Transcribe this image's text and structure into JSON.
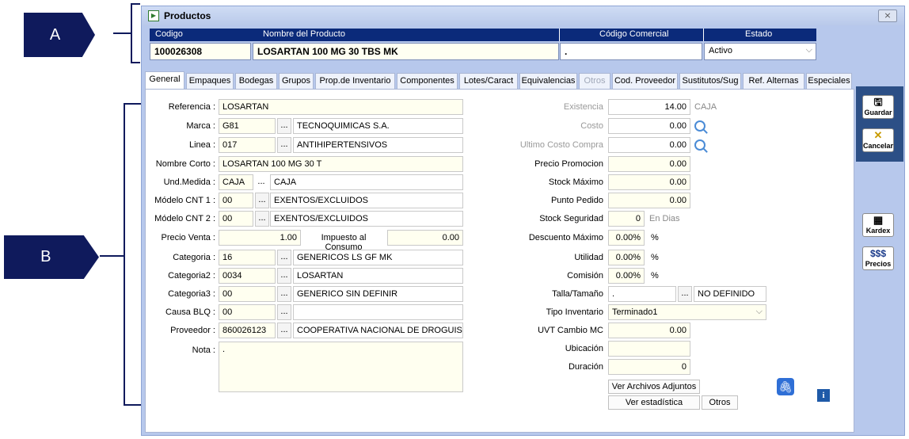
{
  "callouts": {
    "a": "A",
    "b": "B"
  },
  "window": {
    "title": "Productos",
    "close_glyph": "⨯"
  },
  "header": {
    "cols": {
      "codigo": "Codigo",
      "nombre": "Nombre del Producto",
      "comercial": "Código Comercial",
      "estado": "Estado"
    },
    "values": {
      "codigo": "100026308",
      "nombre": "LOSARTAN 100 MG 30 TBS MK",
      "comercial": ".",
      "estado": "Activo"
    }
  },
  "tabs": [
    "General",
    "Empaques",
    "Bodegas",
    "Grupos",
    "Prop.de Inventario",
    "Componentes",
    "Lotes/Caract",
    "Equivalencias",
    "Otros",
    "Cod. Proveedor",
    "Sustitutos/Sug",
    "Ref. Alternas",
    "Especiales"
  ],
  "left": {
    "referencia": {
      "label": "Referencia :",
      "value": "LOSARTAN"
    },
    "marca": {
      "label": "Marca :",
      "code": "G81",
      "desc": "TECNOQUIMICAS S.A."
    },
    "linea": {
      "label": "Linea :",
      "code": "017",
      "desc": "ANTIHIPERTENSIVOS"
    },
    "nombre_corto": {
      "label": "Nombre Corto :",
      "value": "LOSARTAN 100 MG 30 T"
    },
    "und_medida": {
      "label": "Und.Medida :",
      "code": "CAJA",
      "desc": "CAJA"
    },
    "modelo1": {
      "label": "Módelo CNT 1 :",
      "code": "00",
      "desc": "EXENTOS/EXCLUIDOS"
    },
    "modelo2": {
      "label": "Módelo CNT 2 :",
      "code": "00",
      "desc": "EXENTOS/EXCLUIDOS"
    },
    "precio_venta": {
      "label": "Precio Venta :",
      "value": "1.00"
    },
    "impuesto": {
      "label": "Impuesto al Consumo",
      "value": "0.00"
    },
    "categoria": {
      "label": "Categoria :",
      "code": "16",
      "desc": "GENERICOS LS GF MK"
    },
    "categoria2": {
      "label": "Categoria2 :",
      "code": "0034",
      "desc": "LOSARTAN"
    },
    "categoria3": {
      "label": "Categoria3 :",
      "code": "00",
      "desc": "GENERICO SIN DEFINIR"
    },
    "causa_blq": {
      "label": "Causa BLQ :",
      "code": "00",
      "desc": ""
    },
    "proveedor": {
      "label": "Proveedor :",
      "code": "860026123",
      "desc": "COOPERATIVA NACIONAL DE DROGUISTAS D"
    },
    "nota": {
      "label": "Nota :",
      "value": "."
    },
    "dots": "..."
  },
  "right": {
    "existencia": {
      "label": "Existencia",
      "value": "14.00",
      "unit": "CAJA"
    },
    "costo": {
      "label": "Costo",
      "value": "0.00"
    },
    "ultimo_costo": {
      "label": "Ultimo Costo Compra",
      "value": "0.00"
    },
    "precio_promocion": {
      "label": "Precio  Promocion",
      "value": "0.00"
    },
    "stock_max": {
      "label": "Stock Máximo",
      "value": "0.00"
    },
    "punto_pedido": {
      "label": "Punto Pedido",
      "value": "0.00"
    },
    "stock_seg": {
      "label": "Stock Seguridad",
      "value": "0",
      "unit": "En Dias"
    },
    "desc_max": {
      "label": "Descuento Máximo",
      "value": "0.00%",
      "unit": "%"
    },
    "utilidad": {
      "label": "Utilidad",
      "value": "0.00%",
      "unit": "%"
    },
    "comision": {
      "label": "Comisión",
      "value": "0.00%",
      "unit": "%"
    },
    "talla": {
      "label": "Talla/Tamaño",
      "code": ".",
      "desc": "NO DEFINIDO"
    },
    "tipo_inv": {
      "label": "Tipo Inventario",
      "value": "Terminado1"
    },
    "uvt": {
      "label": "UVT Cambio MC",
      "value": "0.00"
    },
    "ubicacion": {
      "label": "Ubicación",
      "value": ""
    },
    "duracion": {
      "label": "Duración",
      "value": "0"
    }
  },
  "buttons": {
    "adjuntos": "Ver Archivos Adjuntos",
    "estadistica": "Ver estadística",
    "otros": "Otros"
  },
  "sidebar": {
    "guardar": "Guardar",
    "cancelar": "Cancelar",
    "kardex": "Kardex",
    "precios_top": "$$$",
    "precios": "Precios"
  },
  "icons": {
    "save": "save-icon",
    "cancel": "cancel-icon",
    "kardex": "kardex-icon",
    "precios": "prices-icon",
    "attach": "paperclip-icon",
    "info": "info-icon",
    "search": "magnifier-icon"
  },
  "colors": {
    "header_bar": "#0b2a7a",
    "window_bg": "#b7c8ec",
    "field_bg": "#fffff0",
    "callout": "#0f1a5c"
  }
}
